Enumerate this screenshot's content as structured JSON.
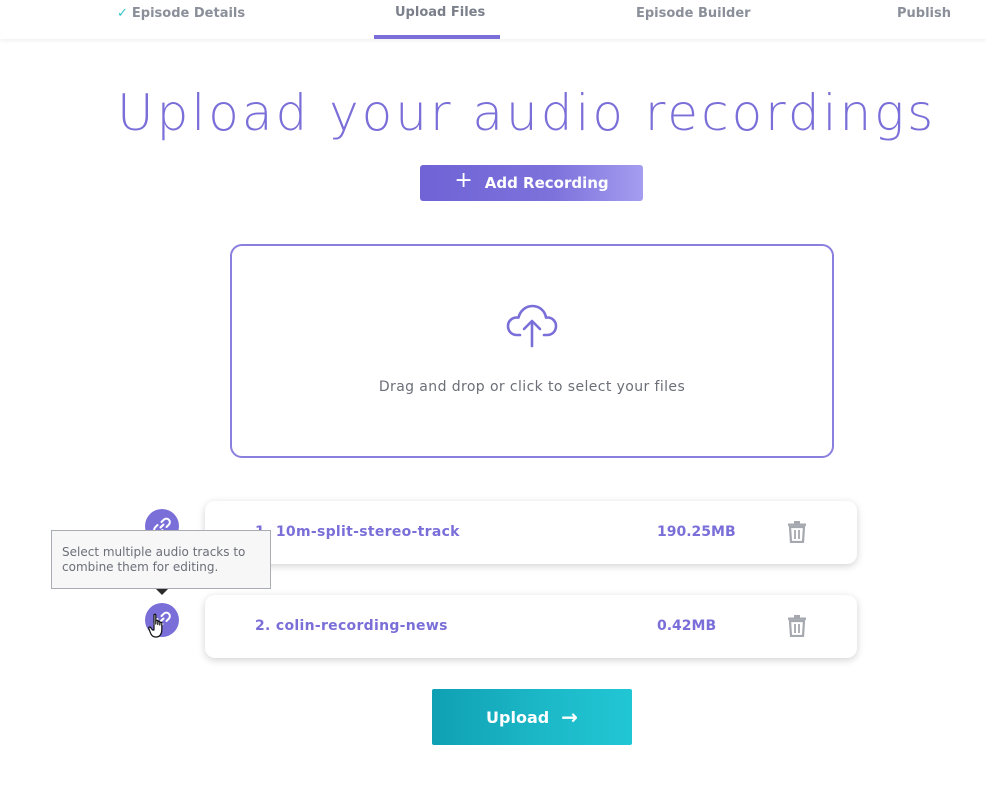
{
  "steps": [
    {
      "label": "Episode Details",
      "state": "done"
    },
    {
      "label": "Upload Files",
      "state": "active"
    },
    {
      "label": "Episode Builder",
      "state": "pending"
    },
    {
      "label": "Publish",
      "state": "pending"
    }
  ],
  "heading": "Upload your audio recordings",
  "add_recording": {
    "label": "Add Recording",
    "icon": "plus-icon"
  },
  "dropzone": {
    "text": "Drag and drop or click to select your files",
    "icon": "cloud-upload-icon"
  },
  "files": [
    {
      "index": "1.",
      "name": "10m-split-stereo-track",
      "size": "190.25MB"
    },
    {
      "index": "2.",
      "name": "colin-recording-news",
      "size": "0.42MB"
    }
  ],
  "tooltip": {
    "text": "Select multiple audio tracks to combine them for editing."
  },
  "upload_button": {
    "label": "Upload",
    "icon": "arrow-right-icon"
  },
  "colors": {
    "accent_purple": "#7a6fd8",
    "accent_teal": "#1cb8c8",
    "check_teal": "#34c3c7",
    "muted_gray": "#8a8f99"
  }
}
